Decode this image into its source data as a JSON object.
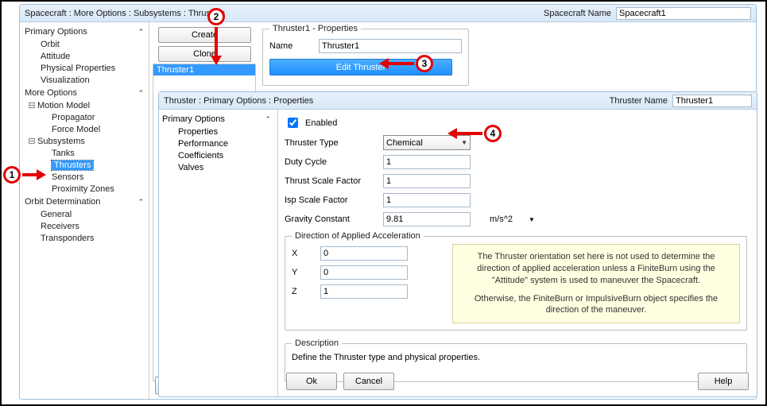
{
  "win1": {
    "breadcrumb": "Spacecraft : More Options : Subsystems : Thrusters",
    "name_label": "Spacecraft Name",
    "name_value": "Spacecraft1",
    "tree": {
      "primary": {
        "head": "Primary Options",
        "items": [
          "Orbit",
          "Attitude",
          "Physical Properties",
          "Visualization"
        ]
      },
      "more": {
        "head": "More Options",
        "motion": {
          "head": "Motion Model",
          "items": [
            "Propagator",
            "Force Model"
          ]
        },
        "subs": {
          "head": "Subsystems",
          "items": [
            "Tanks",
            "Thrusters",
            "Sensors",
            "Proximity Zones"
          ],
          "selected": "Thrusters"
        }
      },
      "orbitdet": {
        "head": "Orbit Determination",
        "items": [
          "General",
          "Receivers",
          "Transponders"
        ]
      }
    },
    "buttons": {
      "create": "Create",
      "clone": "Clone"
    },
    "list": {
      "selected": "Thruster1"
    },
    "prop": {
      "legend": "Thruster1 - Properties",
      "name_label": "Name",
      "name_value": "Thruster1",
      "edit": "Edit Thruster"
    },
    "dlg": {
      "ok": "Ok",
      "cancel": "Cancel",
      "help": "Help"
    }
  },
  "win2": {
    "breadcrumb": "Thruster : Primary Options : Properties",
    "name_label": "Thruster Name",
    "name_value": "Thruster1",
    "tree": {
      "head": "Primary Options",
      "items": [
        "Properties",
        "Performance Coefficients",
        "Valves"
      ],
      "selected": "Properties"
    },
    "form": {
      "enabled_label": "Enabled",
      "enabled": true,
      "ttype_label": "Thruster Type",
      "ttype_value": "Chemical",
      "duty_label": "Duty Cycle",
      "duty": "1",
      "tsf_label": "Thrust Scale Factor",
      "tsf": "1",
      "isf_label": "Isp Scale Factor",
      "isf": "1",
      "grav_label": "Gravity Constant",
      "grav": "9.81",
      "grav_unit": "m/s^2",
      "dir": {
        "legend": "Direction of Applied Acceleration",
        "x_label": "X",
        "x": "0",
        "y_label": "Y",
        "y": "0",
        "z_label": "Z",
        "z": "1",
        "note1": "The Thruster orientation set here is not used to determine the direction of applied acceleration unless a FiniteBurn using the \"Attitude\" system is used to maneuver the Spacecraft.",
        "note2": "Otherwise, the FiniteBurn or ImpulsiveBurn object specifies the direction of the maneuver."
      },
      "desc": {
        "legend": "Description",
        "text": "Define the Thruster type and physical properties."
      }
    },
    "dlg": {
      "ok": "Ok",
      "cancel": "Cancel",
      "help": "Help"
    }
  },
  "callouts": {
    "c1": "1",
    "c2": "2",
    "c3": "3",
    "c4": "4"
  }
}
